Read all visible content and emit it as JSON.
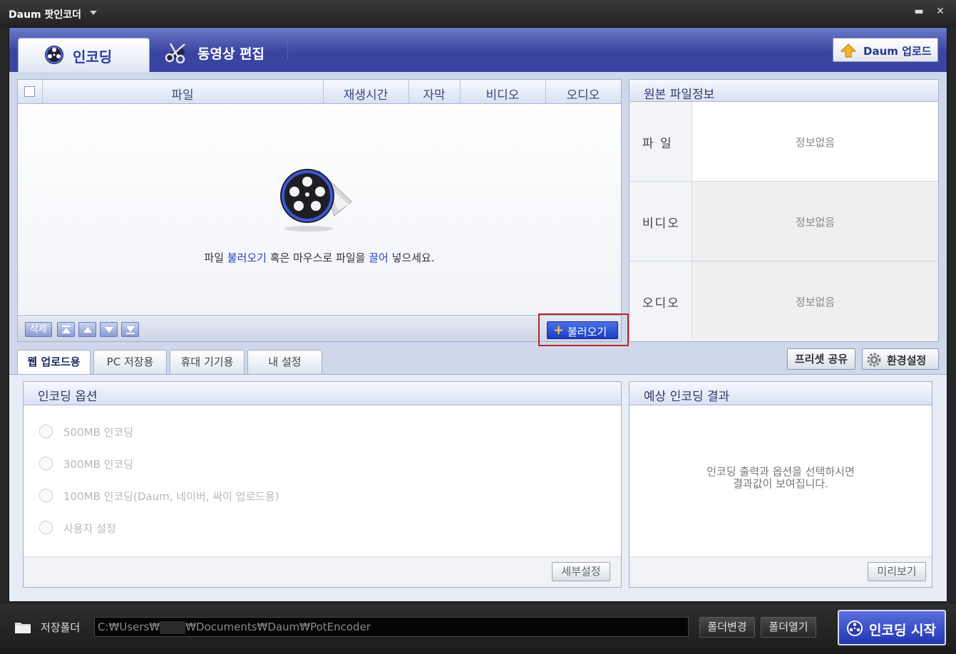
{
  "window": {
    "title": "Daum 팟인코더",
    "minimize": "▬",
    "close": "✕"
  },
  "main_tabs": [
    {
      "label": "인코딩",
      "icon": "film-reel-icon",
      "active": true
    },
    {
      "label": "동영상 편집",
      "icon": "scissors-film-icon",
      "active": false
    }
  ],
  "upload_button": {
    "label": "Daum 업로드",
    "icon": "up-arrow-icon"
  },
  "file_list": {
    "columns": [
      "파일",
      "재생시간",
      "자막",
      "비디오",
      "오디오"
    ],
    "empty_message": {
      "part1": "파일 ",
      "link1": "불러오기",
      "part2": " 혹은 마우스로 파일을 ",
      "link2": "끌어",
      "part3": " 넣으세요."
    },
    "delete_label": "삭제",
    "load_label": "불러오기"
  },
  "source_info": {
    "title": "원본 파일정보",
    "rows": [
      {
        "key": "파 일",
        "value": "정보없음"
      },
      {
        "key": "비디오",
        "value": "정보없음"
      },
      {
        "key": "오디오",
        "value": "정보없음"
      }
    ]
  },
  "preset_tabs": [
    {
      "label": "웹 업로드용",
      "active": true
    },
    {
      "label": "PC 저장용",
      "active": false
    },
    {
      "label": "휴대 기기용",
      "active": false
    },
    {
      "label": "내 설정",
      "active": false
    }
  ],
  "preset_share_label": "프리셋 공유",
  "settings_label": "환경설정",
  "encoding_options": {
    "title": "인코딩 옵션",
    "options": [
      "500MB 인코딩",
      "300MB 인코딩",
      "100MB 인코딩(Daum, 네이버, 싸이 업로드용)",
      "사용자 설정"
    ],
    "detail_label": "세부설정"
  },
  "expected_result": {
    "title": "예상 인코딩 결과",
    "message_line1": "인코딩 출력과 옵션을 선택하시면",
    "message_line2": "결과값이 보여집니다.",
    "preview_label": "미리보기"
  },
  "bottom": {
    "save_folder_label": "저장폴더",
    "path_prefix": "C:₩Users₩",
    "path_suffix": "₩Documents₩Daum₩PotEncoder",
    "change_folder_label": "폴더변경",
    "open_folder_label": "폴더열기",
    "start_label": "인코딩 시작"
  },
  "colors": {
    "accent_blue": "#2a3aa8",
    "highlight_red": "#b3262b",
    "link_blue": "#2a3fcc"
  }
}
